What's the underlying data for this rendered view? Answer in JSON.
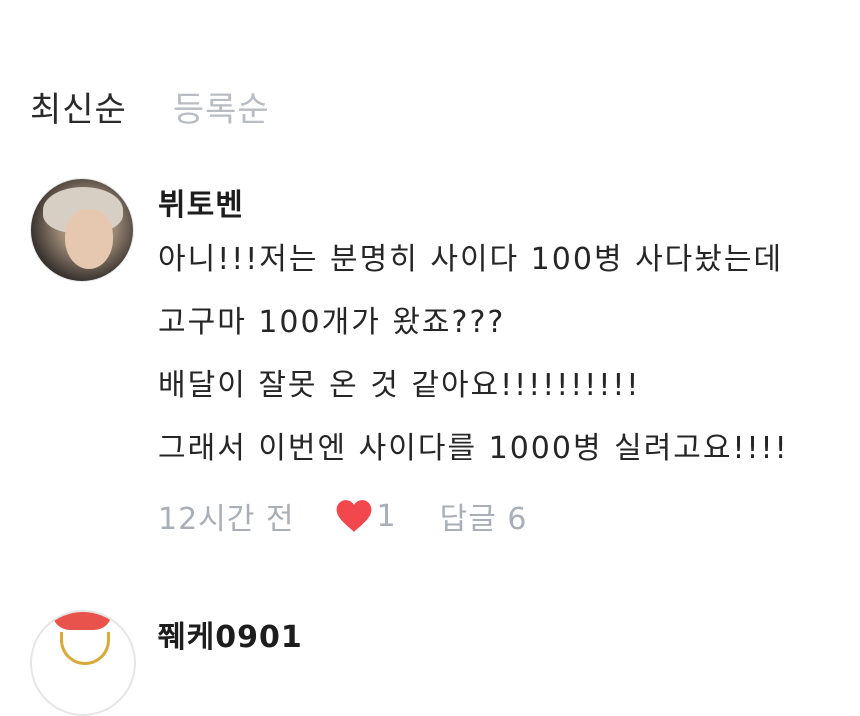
{
  "sort": {
    "latest_label": "최신순",
    "registered_label": "등록순"
  },
  "comments": [
    {
      "author": "뷔토벤",
      "lines": [
        "아니!!!저는 분명히 사이다 100병 사다놨는데",
        "고구마 100개가 왔죠???",
        "배달이 잘못 온 것 같아요!!!!!!!!!!",
        "그래서 이번엔 사이다를 1000병 실려고요!!!!"
      ],
      "time": "12시간 전",
      "like_count": "1",
      "reply_label": "답글 6"
    },
    {
      "author": "쮀케0901"
    }
  ],
  "colors": {
    "heart": "#f2484d",
    "muted_text": "#a8afb6",
    "inactive_tab": "#b8bdc3"
  },
  "icons": {
    "like": "heart-icon"
  }
}
